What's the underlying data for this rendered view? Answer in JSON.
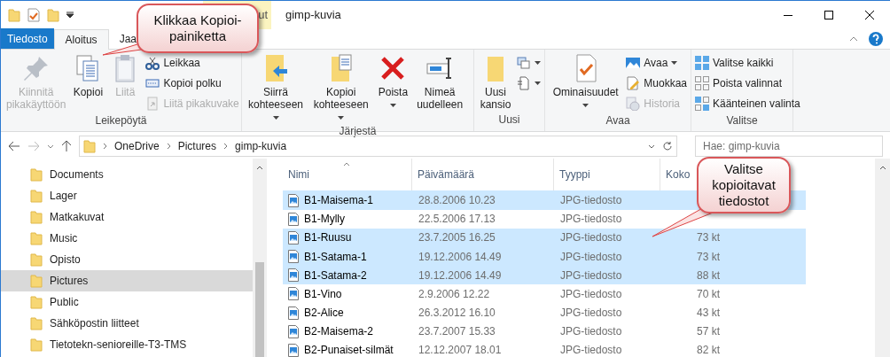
{
  "title_bar": {
    "context_tab": "ut",
    "title": "gimp-kuvia"
  },
  "tabs": [
    {
      "label": "Tiedosto",
      "kind": "file",
      "selected": false
    },
    {
      "label": "Aloitus",
      "kind": "tab",
      "selected": true
    },
    {
      "label": "Jaa",
      "kind": "tab",
      "selected": false
    }
  ],
  "ribbon": {
    "groups": [
      {
        "label": "Leikepöytä",
        "items": [
          {
            "kind": "large",
            "label": "Kiinnitä pikakäyttöön",
            "disabled": true,
            "dropdown": false
          },
          {
            "kind": "large",
            "label": "Kopioi",
            "disabled": false,
            "dropdown": false
          },
          {
            "kind": "large",
            "label": "Liitä",
            "disabled": true,
            "dropdown": false
          },
          {
            "kind": "small",
            "label": "Leikkaa",
            "disabled": false,
            "dropdown": false
          },
          {
            "kind": "small",
            "label": "Kopioi polku",
            "disabled": false,
            "dropdown": false
          },
          {
            "kind": "small",
            "label": "Liitä pikakuvake",
            "disabled": true,
            "dropdown": false
          }
        ]
      },
      {
        "label": "Järjestä",
        "items": [
          {
            "kind": "large",
            "label": "Siirrä kohteeseen",
            "disabled": false,
            "dropdown": true
          },
          {
            "kind": "large",
            "label": "Kopioi kohteeseen",
            "disabled": false,
            "dropdown": true
          },
          {
            "kind": "large",
            "label": "Poista",
            "disabled": false,
            "dropdown": true
          },
          {
            "kind": "large",
            "label": "Nimeä uudelleen",
            "disabled": false,
            "dropdown": false
          }
        ]
      },
      {
        "label": "Uusi",
        "items": [
          {
            "kind": "large",
            "label": "Uusi kansio",
            "disabled": false,
            "dropdown": false
          },
          {
            "kind": "iconsmall",
            "disabled": false,
            "dropdown": true
          },
          {
            "kind": "iconsmall",
            "disabled": false,
            "dropdown": true
          }
        ]
      },
      {
        "label": "Avaa",
        "items": [
          {
            "kind": "large",
            "label": "Ominaisuudet",
            "disabled": false,
            "dropdown": true
          },
          {
            "kind": "small",
            "label": "Avaa",
            "disabled": false,
            "dropdown": true
          },
          {
            "kind": "small",
            "label": "Muokkaa",
            "disabled": false,
            "dropdown": false
          },
          {
            "kind": "small",
            "label": "Historia",
            "disabled": true,
            "dropdown": false
          }
        ]
      },
      {
        "label": "Valitse",
        "items": [
          {
            "kind": "small",
            "label": "Valitse kaikki",
            "disabled": false,
            "dropdown": false
          },
          {
            "kind": "small",
            "label": "Poista valinnat",
            "disabled": false,
            "dropdown": false
          },
          {
            "kind": "small",
            "label": "Käänteinen valinta",
            "disabled": false,
            "dropdown": false
          }
        ]
      }
    ]
  },
  "address_bar": {
    "path": [
      "OneDrive",
      "Pictures",
      "gimp-kuvia"
    ],
    "search": {
      "placeholder": "Hae: gimp-kuvia"
    }
  },
  "sidebar": {
    "items": [
      {
        "label": "Documents",
        "selected": false
      },
      {
        "label": "Lager",
        "selected": false
      },
      {
        "label": "Matkakuvat",
        "selected": false
      },
      {
        "label": "Music",
        "selected": false
      },
      {
        "label": "Opisto",
        "selected": false
      },
      {
        "label": "Pictures",
        "selected": true
      },
      {
        "label": "Public",
        "selected": false
      },
      {
        "label": "Sähköpostin liitteet",
        "selected": false
      },
      {
        "label": "Tietotekn-senioreille-T3-TMS",
        "selected": false
      }
    ]
  },
  "file_list": {
    "columns": [
      "Nimi",
      "Päivämäärä",
      "Tyyppi",
      "Koko"
    ],
    "rows": [
      {
        "name": "B1-Maisema-1",
        "date": "28.8.2006 10.23",
        "type": "JPG-tiedosto",
        "selected": true
      },
      {
        "name": "B1-Mylly",
        "date": "22.5.2006 17.13",
        "type": "JPG-tiedosto",
        "selected": false
      },
      {
        "name": "B1-Ruusu",
        "date": "23.7.2005 16.25",
        "type": "JPG-tiedosto",
        "size": "73 kt",
        "selected": true
      },
      {
        "name": "B1-Satama-1",
        "date": "19.12.2006 14.49",
        "type": "JPG-tiedosto",
        "size": "73 kt",
        "selected": true
      },
      {
        "name": "B1-Satama-2",
        "date": "19.12.2006 14.49",
        "type": "JPG-tiedosto",
        "size": "88 kt",
        "selected": true
      },
      {
        "name": "B1-Vino",
        "date": "2.9.2006 12.22",
        "type": "JPG-tiedosto",
        "size": "70 kt",
        "selected": false
      },
      {
        "name": "B2-Alice",
        "date": "26.3.2012 16.10",
        "type": "JPG-tiedosto",
        "size": "43 kt",
        "selected": false
      },
      {
        "name": "B2-Maisema-2",
        "date": "23.7.2007 15.33",
        "type": "JPG-tiedosto",
        "size": "57 kt",
        "selected": false
      },
      {
        "name": "B2-Punaiset-silmät",
        "date": "12.12.2007 18.01",
        "type": "JPG-tiedosto",
        "size": "82 kt",
        "selected": false
      }
    ]
  },
  "callouts": [
    {
      "text": "Klikkaa Kopioi-painiketta"
    },
    {
      "text": "Valitse kopioitavat tiedostot"
    }
  ]
}
